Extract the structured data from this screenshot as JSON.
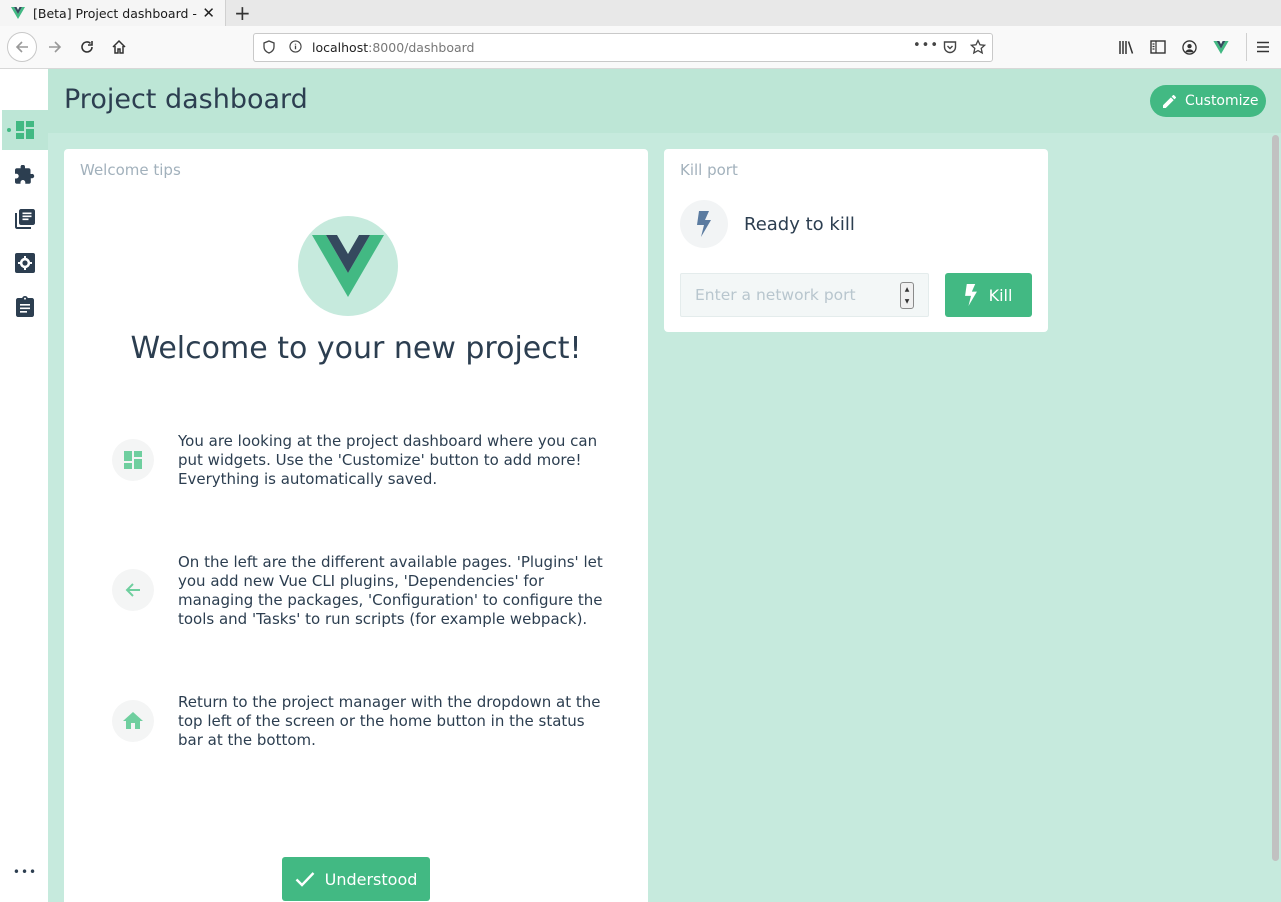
{
  "browser": {
    "tab_title": "[Beta] Project dashboard - Vue UI",
    "url_host": "localhost",
    "url_path": ":8000/dashboard",
    "new_tab_label": "+"
  },
  "header": {
    "title": "Project dashboard",
    "customize_label": "Customize"
  },
  "sidebar": {
    "items": [
      {
        "name": "dashboard",
        "icon": "dashboard-icon",
        "active": true
      },
      {
        "name": "plugins",
        "icon": "puzzle-icon"
      },
      {
        "name": "dependencies",
        "icon": "library-books-icon"
      },
      {
        "name": "configuration",
        "icon": "settings-icon"
      },
      {
        "name": "tasks",
        "icon": "assignment-icon"
      }
    ],
    "more_label": "•••"
  },
  "welcome": {
    "title": "Welcome tips",
    "heading": "Welcome to your new project!",
    "tips": [
      {
        "icon": "dashboard-icon",
        "text": "You are looking at the project dashboard where you can put widgets. Use the 'Customize' button to add more! Everything is automatically saved."
      },
      {
        "icon": "arrow-back-icon",
        "text": "On the left are the different available pages. 'Plugins' let you add new Vue CLI plugins, 'Dependencies' for managing the packages, 'Configuration' to configure the tools and 'Tasks' to run scripts (for example webpack)."
      },
      {
        "icon": "home-icon",
        "text": "Return to the project manager with the dropdown at the top left of the screen or the home button in the status bar at the bottom."
      }
    ],
    "understood_label": "Understood"
  },
  "kill_port": {
    "title": "Kill port",
    "status": "Ready to kill",
    "input_placeholder": "Enter a network port",
    "input_value": "",
    "kill_label": "Kill"
  },
  "colors": {
    "accent": "#42b983",
    "header_bg": "#bde6d6",
    "main_bg": "#c6eadd",
    "text": "#2c3e50",
    "vue_dark": "#35495e"
  }
}
